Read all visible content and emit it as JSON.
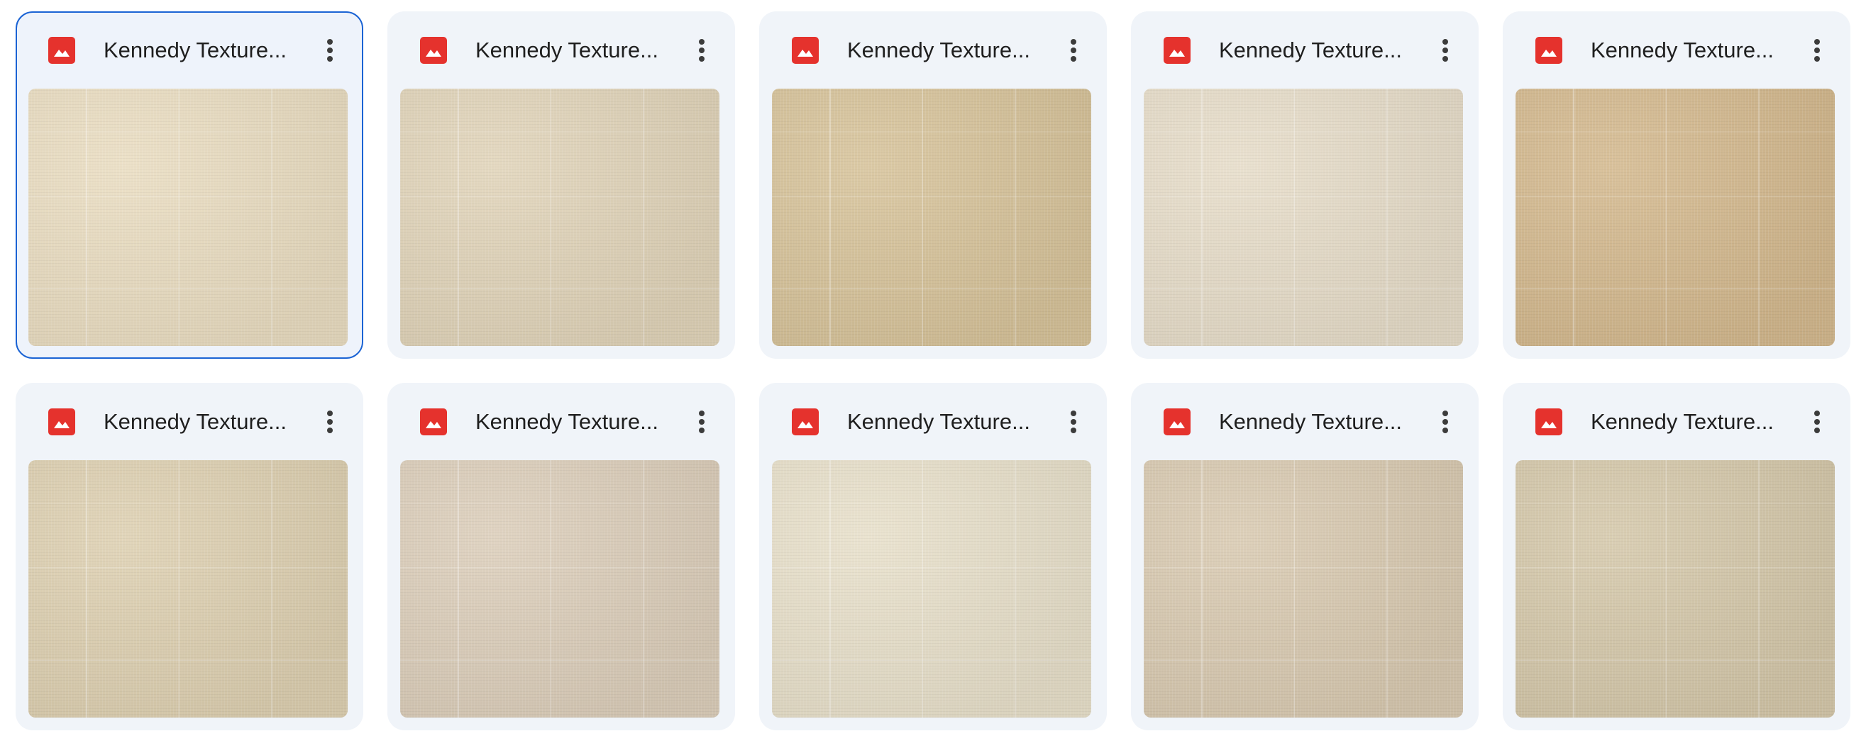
{
  "files": [
    {
      "name": "Kennedy Texture...",
      "selected": true,
      "swatch": "#e9dcc0"
    },
    {
      "name": "Kennedy Texture...",
      "selected": false,
      "swatch": "#e0d3b8"
    },
    {
      "name": "Kennedy Texture...",
      "selected": false,
      "swatch": "#d6c299"
    },
    {
      "name": "Kennedy Texture...",
      "selected": false,
      "swatch": "#e6dcc8"
    },
    {
      "name": "Kennedy Texture...",
      "selected": false,
      "swatch": "#d3b88d"
    },
    {
      "name": "Kennedy Texture...",
      "selected": false,
      "swatch": "#ddcfb0"
    },
    {
      "name": "Kennedy Texture...",
      "selected": false,
      "swatch": "#dbcdb9"
    },
    {
      "name": "Kennedy Texture...",
      "selected": false,
      "swatch": "#e7dfc9"
    },
    {
      "name": "Kennedy Texture...",
      "selected": false,
      "swatch": "#d8c9b0"
    },
    {
      "name": "Kennedy Texture...",
      "selected": false,
      "swatch": "#d4c7a9"
    }
  ],
  "icons": {
    "file_type": "image-file-icon",
    "more": "more-vert-icon"
  },
  "colors": {
    "card_bg": "#f0f4f9",
    "selected_border": "#1a63d4",
    "image_icon": "#e5322d"
  }
}
